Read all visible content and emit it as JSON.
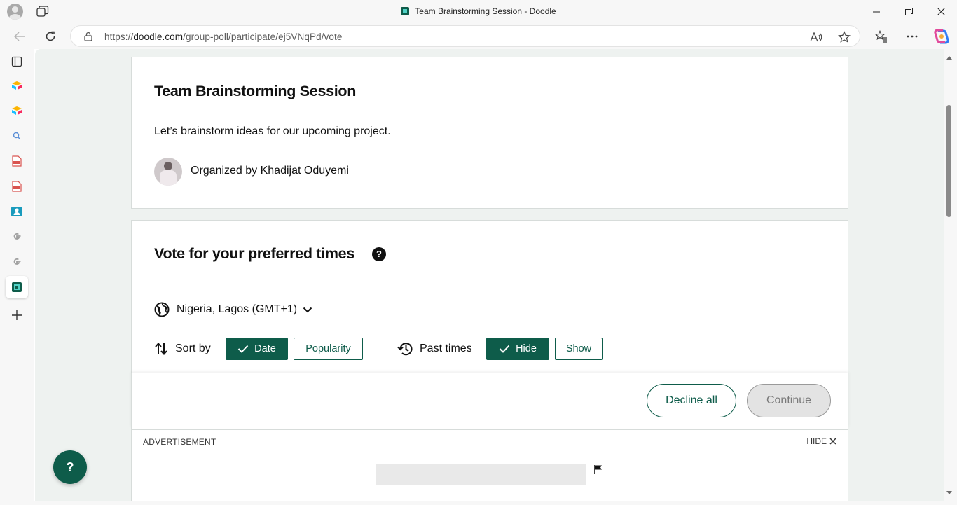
{
  "browser": {
    "tab_title": "Team Brainstorming Session - Doodle",
    "url_scheme": "https://",
    "url_host": "doodle.com",
    "url_path": "/group-poll/participate/ej5VNqPd/vote"
  },
  "sidebar": {
    "icons": [
      "tab-actions-icon",
      "airtable-icon",
      "airtable-icon",
      "search-icon",
      "pdf-icon",
      "pdf-icon",
      "contact-card-icon",
      "google-icon",
      "google-icon",
      "doodle-icon",
      "add-icon"
    ]
  },
  "poll": {
    "title": "Team Brainstorming Session",
    "description": "Let’s brainstorm ideas for our upcoming project.",
    "organizer": "Organized by Khadijat Oduyemi"
  },
  "vote": {
    "heading": "Vote for your preferred times",
    "help": "?",
    "timezone": "Nigeria, Lagos (GMT+1)",
    "sort_label": "Sort by",
    "sort_date": "Date",
    "sort_popularity": "Popularity",
    "past_label": "Past times",
    "past_hide": "Hide",
    "past_show": "Show"
  },
  "actions": {
    "decline": "Decline all",
    "continue": "Continue"
  },
  "ad": {
    "label": "ADVERTISEMENT",
    "hide": "HIDE"
  },
  "help_button": "?",
  "colors": {
    "brand_green": "#0e5c4a",
    "page_bg": "#eef2f0"
  }
}
